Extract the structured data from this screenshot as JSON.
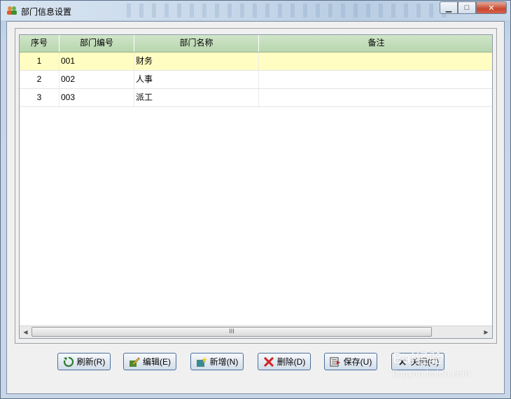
{
  "window": {
    "title": "部门信息设置"
  },
  "grid": {
    "columns": [
      "序号",
      "部门编号",
      "部门名称",
      "备注"
    ],
    "rows": [
      {
        "no": "1",
        "code": "001",
        "name": "财务",
        "note": ""
      },
      {
        "no": "2",
        "code": "002",
        "name": "人事",
        "note": ""
      },
      {
        "no": "3",
        "code": "003",
        "name": "派工",
        "note": ""
      }
    ],
    "selected_row": 0,
    "scroll_thumb_glyph": "III"
  },
  "buttons": {
    "refresh": "刷新(R)",
    "edit": "编辑(E)",
    "add": "新增(N)",
    "delete": "删除(D)",
    "save": "保存(U)",
    "close": "关闭(C)"
  },
  "watermark": {
    "brand": "Bai经验",
    "site": "jingyan.baidu.com"
  },
  "colors": {
    "header": "#b8d6ae",
    "selected_row": "#fffdc2",
    "close": "#c8482f"
  }
}
